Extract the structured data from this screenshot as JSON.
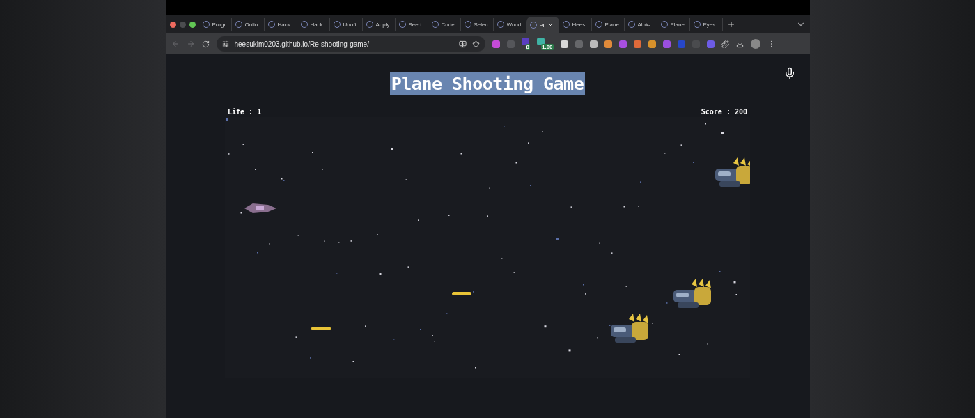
{
  "tabs": [
    {
      "label": "Progr",
      "selected": false
    },
    {
      "label": "Onlin",
      "selected": false
    },
    {
      "label": "Hack",
      "selected": false
    },
    {
      "label": "Hack",
      "selected": false
    },
    {
      "label": "Unofi",
      "selected": false
    },
    {
      "label": "Apply",
      "selected": false
    },
    {
      "label": "Seed",
      "selected": false
    },
    {
      "label": "Code",
      "selected": false
    },
    {
      "label": "Selec",
      "selected": false
    },
    {
      "label": "Wood",
      "selected": false
    },
    {
      "label": "Pl",
      "selected": true
    },
    {
      "label": "Hees",
      "selected": false
    },
    {
      "label": "Plane",
      "selected": false
    },
    {
      "label": "Alok-",
      "selected": false
    },
    {
      "label": "Plane",
      "selected": false
    },
    {
      "label": "Eyes",
      "selected": false
    }
  ],
  "address": "heesukim0203.github.io/Re-shooting-game/",
  "extension_badges": [
    "8",
    "1.00"
  ],
  "game": {
    "title": "Plane Shooting Game",
    "title_selected": true,
    "life": "Life : 1",
    "score": "Score : 200"
  }
}
